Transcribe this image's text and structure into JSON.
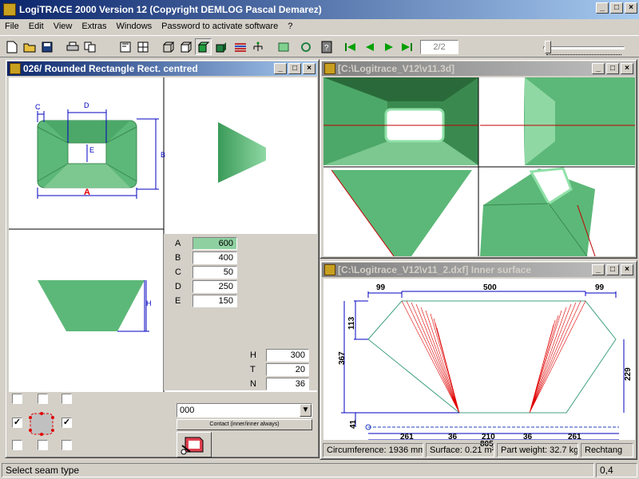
{
  "app": {
    "title": "LogiTRACE 2000  Version 12  (Copyright DEMLOG Pascal Demarez)"
  },
  "menu": [
    "File",
    "Edit",
    "View",
    "Extras",
    "Windows",
    "Password to activate software",
    "?"
  ],
  "toolbar": {
    "page_indicator": "2/2"
  },
  "window_left": {
    "title": "026/ Rounded Rectangle Rect. centred",
    "labels": {
      "A": "A",
      "B": "B",
      "C": "C",
      "D": "D",
      "E": "E",
      "H": "H"
    },
    "params": [
      {
        "label": "A",
        "value": "600"
      },
      {
        "label": "B",
        "value": "400"
      },
      {
        "label": "C",
        "value": "50"
      },
      {
        "label": "D",
        "value": "250"
      },
      {
        "label": "E",
        "value": "150"
      }
    ],
    "params2": [
      {
        "label": "H",
        "value": "300"
      },
      {
        "label": "T",
        "value": "20"
      },
      {
        "label": "N",
        "value": "36"
      }
    ],
    "seam_select": "000",
    "contact_button": "Contact (inner/inner always)"
  },
  "window_3d": {
    "title": "[C:\\Logitrace_V12\\v11.3d]"
  },
  "window_dxf": {
    "title": "[C:\\Logitrace_V12\\v11_2.dxf]  Inner surface",
    "dims": {
      "top_left": "99",
      "top_mid": "500",
      "top_right": "99",
      "left_upper": "113",
      "left_total": "367",
      "right": "229",
      "left_bottom": "41",
      "b1": "261",
      "b2": "36",
      "b3": "210",
      "b4": "36",
      "b5": "261",
      "total": "805"
    },
    "info": [
      "Circumference: 1936 mm",
      "Surface: 0.21 m²",
      "Part weight: 32.7 kg",
      "Rechtang"
    ]
  },
  "status": {
    "message": "Select seam type",
    "value": "0,4"
  },
  "colors": {
    "title_active": "#0a246a",
    "shape_green": "#5cb878",
    "selected_field": "#8fd0a0"
  }
}
